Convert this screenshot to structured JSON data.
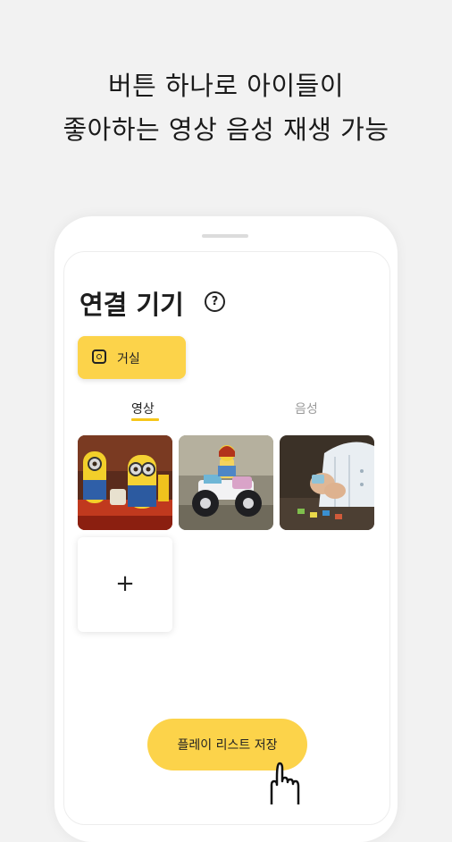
{
  "headline": {
    "line1": "버튼 하나로 아이들이",
    "line2": "좋아하는 영상 음성 재생 가능"
  },
  "screen": {
    "title": "연결 기기",
    "help_icon": "?",
    "device": {
      "label": "거실",
      "icon": "speaker-icon"
    },
    "tabs": [
      {
        "label": "영상",
        "active": true
      },
      {
        "label": "음성",
        "active": false
      }
    ],
    "thumbnails": [
      {
        "subject": "minion-toys"
      },
      {
        "subject": "lego-truck"
      },
      {
        "subject": "child-playing"
      }
    ],
    "add_icon": "+",
    "save_button": {
      "label": "플레이 리스트 저장"
    }
  },
  "colors": {
    "accent": "#fcd34a",
    "background": "#f2f2f2",
    "text": "#1d1d1d",
    "inactive_tab": "#9a9a9a"
  }
}
